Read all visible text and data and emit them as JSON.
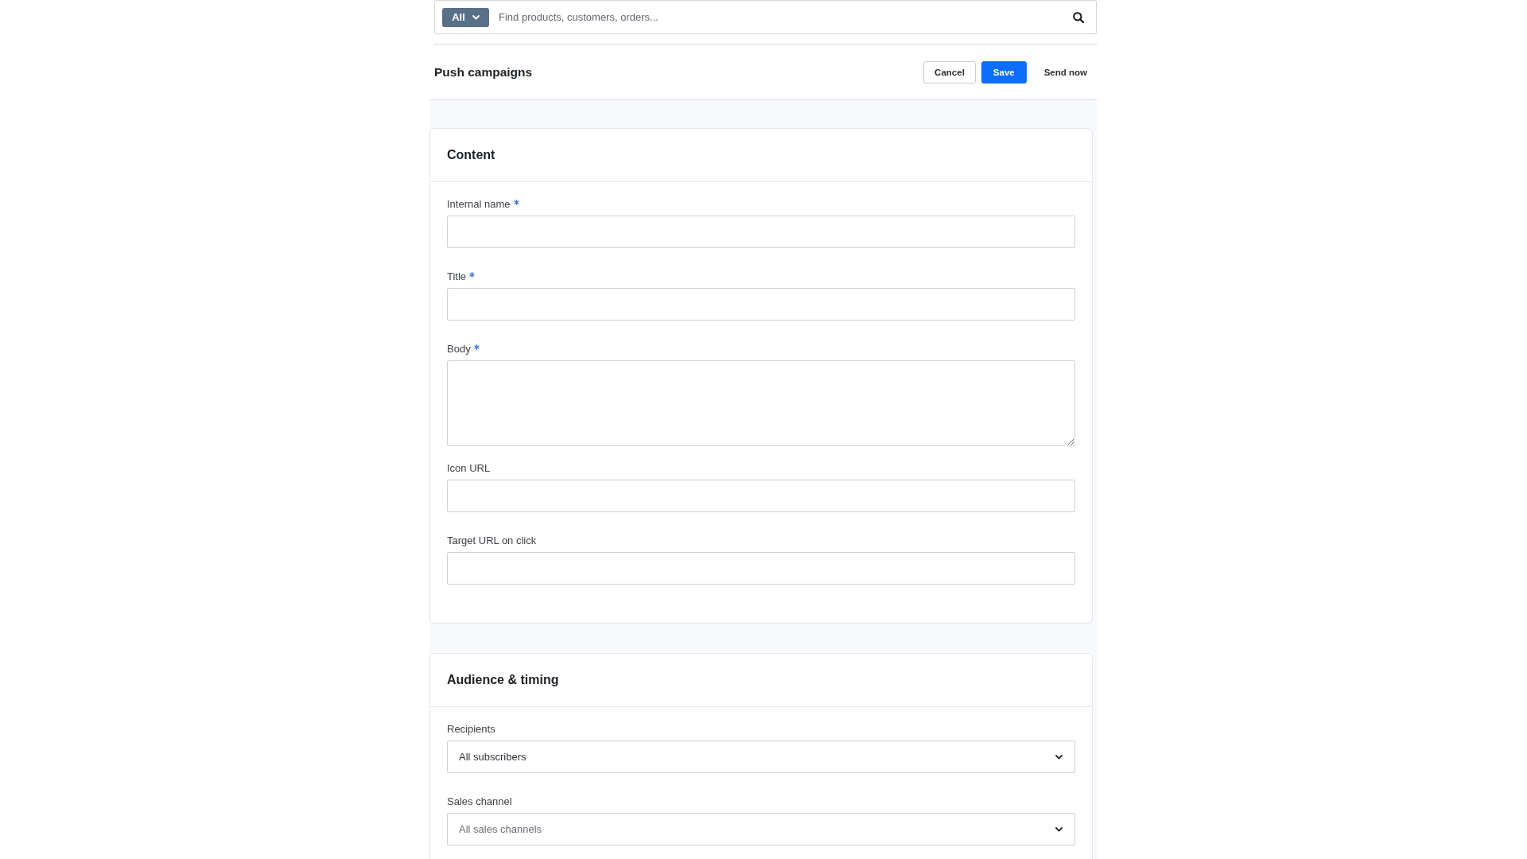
{
  "search": {
    "scope": "All",
    "placeholder": "Find products, customers, orders..."
  },
  "header": {
    "title": "Push campaigns",
    "actions": [
      {
        "label": "Cancel",
        "kind": "secondary"
      },
      {
        "label": "Save",
        "kind": "primary"
      },
      {
        "label": "Send now",
        "kind": "plain"
      }
    ]
  },
  "sections": [
    {
      "title": "Content",
      "fields": [
        {
          "label": "Internal name",
          "required": true,
          "kind": "text"
        },
        {
          "label": "Title",
          "required": true,
          "kind": "text"
        },
        {
          "label": "Body",
          "required": true,
          "kind": "textarea"
        },
        {
          "label": "Icon URL",
          "required": false,
          "kind": "text"
        },
        {
          "label": "Target URL on click",
          "required": false,
          "kind": "text"
        }
      ]
    },
    {
      "title": "Audience & timing",
      "fields": [
        {
          "label": "Recipients",
          "required": false,
          "kind": "select",
          "value": "All subscribers"
        },
        {
          "label": "Sales channel",
          "required": false,
          "kind": "select",
          "placeholder": "All sales channels"
        }
      ]
    }
  ]
}
